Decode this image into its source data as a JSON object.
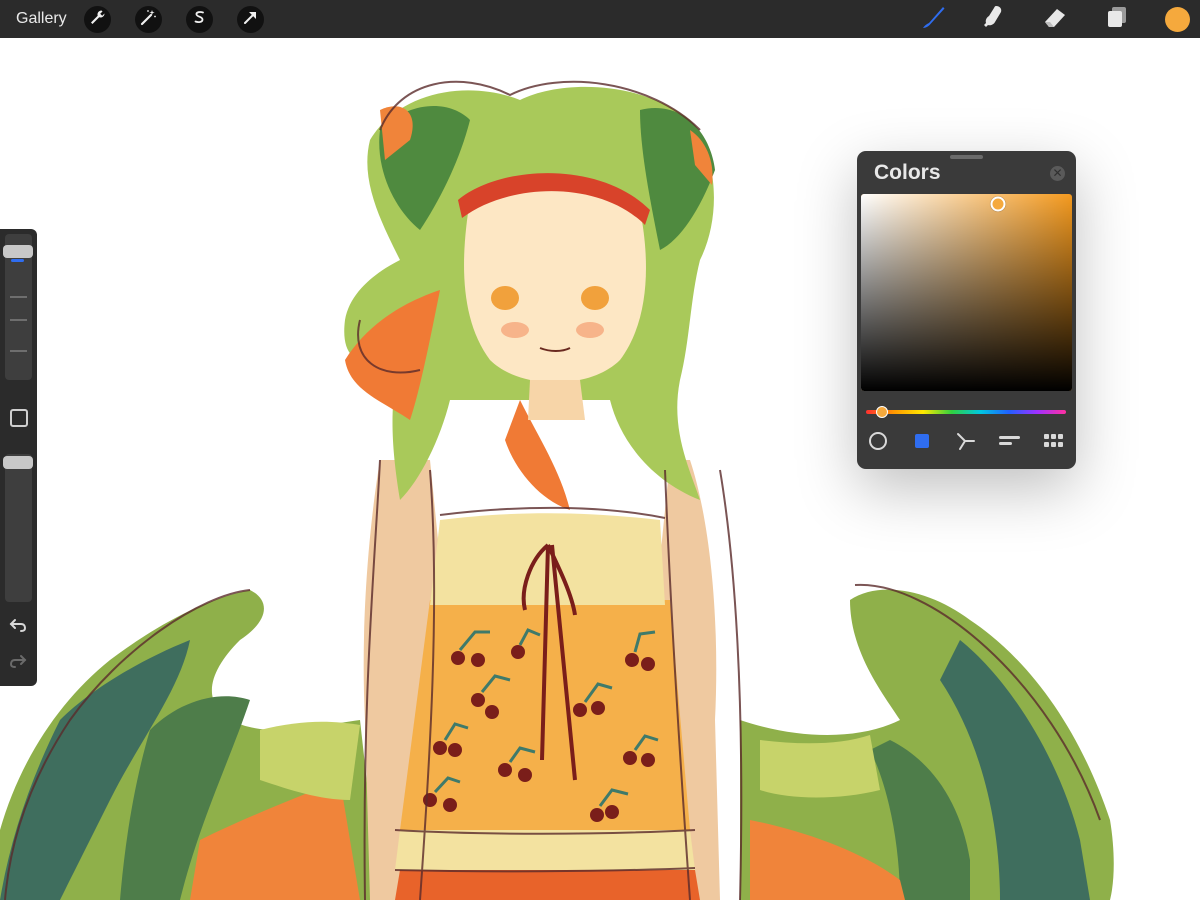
{
  "toolbar": {
    "gallery_label": "Gallery",
    "left_tools": [
      {
        "name": "wrench-icon",
        "label": "Actions"
      },
      {
        "name": "magic-wand-icon",
        "label": "Adjustments"
      },
      {
        "name": "selection-s-icon",
        "label": "Selection"
      },
      {
        "name": "arrow-cursor-icon",
        "label": "Transform"
      }
    ],
    "right_tools": [
      {
        "name": "brush-icon",
        "active": true
      },
      {
        "name": "smudge-icon",
        "active": false
      },
      {
        "name": "eraser-icon",
        "active": false
      },
      {
        "name": "layers-icon",
        "active": false
      }
    ],
    "current_color": "#f5a93d"
  },
  "sidebar": {
    "brush_size": 0.92,
    "opacity": 1.0,
    "icons": [
      "modify-square-icon",
      "undo-icon",
      "redo-icon"
    ]
  },
  "colors_panel": {
    "title": "Colors",
    "hue_color": "#f49a1f",
    "saturation": 0.65,
    "brightness": 0.95,
    "hue_position": 0.08,
    "modes": [
      "disc-mode-icon",
      "classic-mode-icon",
      "harmony-mode-icon",
      "value-mode-icon",
      "palettes-mode-icon"
    ],
    "active_mode": 1
  },
  "colors": {
    "toolbar_bg": "#2b2b2b",
    "accent_blue": "#2f6df0",
    "panel_bg": "#3a3a3a"
  }
}
